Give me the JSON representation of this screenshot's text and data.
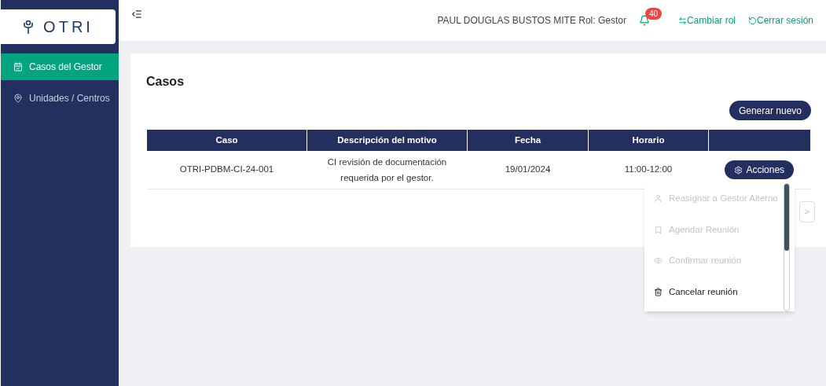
{
  "logo": {
    "text": "OTRI"
  },
  "sidebar": {
    "items": [
      {
        "label": "Casos del Gestor",
        "selected": true
      },
      {
        "label": "Unidades / Centros",
        "selected": false
      }
    ]
  },
  "header": {
    "user": "PAUL DOUGLAS BUSTOS MITE Rol: Gestor",
    "notifications": "40",
    "actions": [
      "Cambiar rol",
      "Cerrar sesión"
    ]
  },
  "page": {
    "title": "Casos",
    "new_button": "Generar nuevo"
  },
  "table": {
    "columns": [
      "Caso",
      "Descripción del motivo",
      "Fecha",
      "Horario",
      ""
    ],
    "rows": [
      {
        "caso": "OTRI-PDBM-CI-24-001",
        "descripcion": "CI revisión de documentación requerida por el gestor.",
        "fecha": "19/01/2024",
        "horario": "11:00-12:00",
        "action": "Acciones"
      }
    ]
  },
  "pagination": {
    "next": ">"
  },
  "menu": {
    "items": [
      {
        "label": "Reasignar a Gestor Alterno",
        "disabled": true
      },
      {
        "label": "Agendar Reunión",
        "disabled": true
      },
      {
        "label": "Confirmar reunión",
        "disabled": true
      },
      {
        "label": "Cancelar reunión",
        "disabled": false
      }
    ]
  }
}
